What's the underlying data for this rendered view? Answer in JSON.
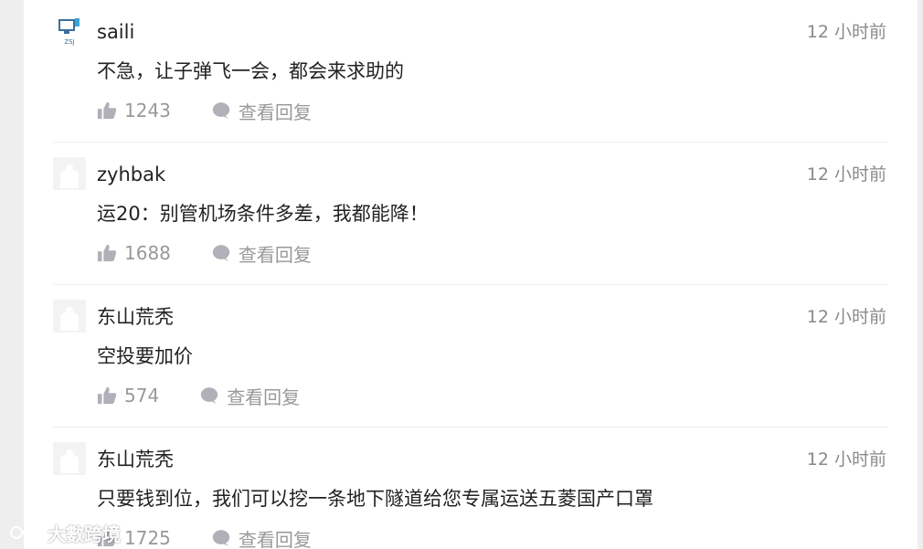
{
  "comments": [
    {
      "user": "saili",
      "time": "12 小时前",
      "text": "不急，让子弹飞一会，都会来求助的",
      "likes": "1243",
      "reply_label": "查看回复",
      "avatar": "logo-avatar"
    },
    {
      "user": "zyhbak",
      "time": "12 小时前",
      "text": "运20：别管机场条件多差，我都能降！",
      "likes": "1688",
      "reply_label": "查看回复",
      "avatar": "default-avatar"
    },
    {
      "user": "东山荒秃",
      "time": "12 小时前",
      "text": "空投要加价",
      "likes": "574",
      "reply_label": "查看回复",
      "avatar": "default-avatar"
    },
    {
      "user": "东山荒秃",
      "time": "12 小时前",
      "text": "只要钱到位，我们可以挖一条地下隧道给您专属运送五菱国产口罩",
      "likes": "1725",
      "reply_label": "查看回复",
      "avatar": "default-avatar"
    }
  ],
  "avatar_logo_text": "ZSJ",
  "watermark": {
    "text": "大數跨境"
  },
  "colors": {
    "text": "#222222",
    "muted": "#999999",
    "time": "#8a8a8a",
    "icon": "#b0b0b8"
  }
}
